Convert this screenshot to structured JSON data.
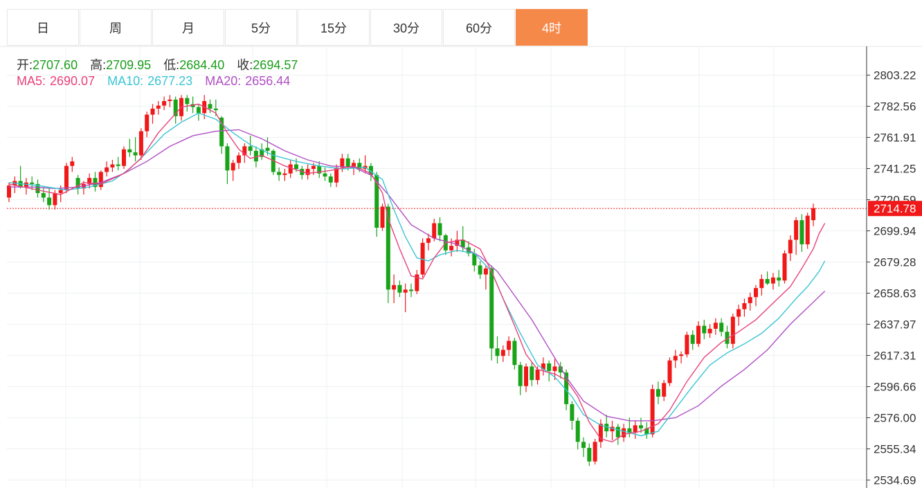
{
  "tabs": [
    {
      "label": "日",
      "active": false
    },
    {
      "label": "周",
      "active": false
    },
    {
      "label": "月",
      "active": false
    },
    {
      "label": "5分",
      "active": false
    },
    {
      "label": "15分",
      "active": false
    },
    {
      "label": "30分",
      "active": false
    },
    {
      "label": "60分",
      "active": false
    },
    {
      "label": "4时",
      "active": true
    }
  ],
  "info": {
    "open_label": "开:",
    "open": "2707.60",
    "high_label": "高:",
    "high": "2709.95",
    "low_label": "低:",
    "low": "2684.40",
    "close_label": "收:",
    "close": "2694.57",
    "ma5_label": "MA5:",
    "ma5": "2690.07",
    "ma10_label": "MA10:",
    "ma10": "2677.23",
    "ma20_label": "MA20:",
    "ma20": "2656.44"
  },
  "colors": {
    "up": "#f01818",
    "down": "#19a319",
    "ma5": "#e8417a",
    "ma10": "#3bc4d4",
    "ma20": "#b04ec4",
    "tab_active": "#f5894a"
  },
  "chart_data": {
    "type": "candlestick",
    "y_ticks": [
      "2803.22",
      "2782.56",
      "2761.91",
      "2741.25",
      "2720.59",
      "2699.94",
      "2679.28",
      "2658.63",
      "2637.97",
      "2617.31",
      "2596.66",
      "2576.00",
      "2555.34",
      "2534.69"
    ],
    "ylim": [
      2534.69,
      2803.22
    ],
    "current_price": "2714.78",
    "grid": true,
    "candles": [
      [
        2722,
        2732,
        2719,
        2730
      ],
      [
        2730,
        2736,
        2725,
        2733
      ],
      [
        2733,
        2743,
        2728,
        2729
      ],
      [
        2729,
        2735,
        2724,
        2732
      ],
      [
        2732,
        2736,
        2727,
        2731
      ],
      [
        2731,
        2734,
        2722,
        2725
      ],
      [
        2725,
        2729,
        2719,
        2722
      ],
      [
        2722,
        2728,
        2714,
        2717
      ],
      [
        2717,
        2727,
        2714,
        2725
      ],
      [
        2725,
        2730,
        2719,
        2727
      ],
      [
        2727,
        2745,
        2725,
        2743
      ],
      [
        2743,
        2749,
        2739,
        2746
      ],
      [
        2735,
        2737,
        2724,
        2728
      ],
      [
        2728,
        2733,
        2724,
        2731
      ],
      [
        2731,
        2738,
        2728,
        2735
      ],
      [
        2735,
        2739,
        2726,
        2729
      ],
      [
        2729,
        2740,
        2727,
        2739
      ],
      [
        2739,
        2746,
        2736,
        2742
      ],
      [
        2742,
        2747,
        2739,
        2744
      ],
      [
        2744,
        2749,
        2740,
        2743
      ],
      [
        2743,
        2756,
        2741,
        2754
      ],
      [
        2754,
        2761,
        2749,
        2752
      ],
      [
        2752,
        2762,
        2746,
        2750
      ],
      [
        2750,
        2768,
        2747,
        2766
      ],
      [
        2766,
        2779,
        2762,
        2777
      ],
      [
        2777,
        2784,
        2771,
        2781
      ],
      [
        2781,
        2786,
        2777,
        2783
      ],
      [
        2783,
        2789,
        2780,
        2786
      ],
      [
        2786,
        2790,
        2782,
        2787
      ],
      [
        2787,
        2789,
        2771,
        2776
      ],
      [
        2776,
        2790,
        2773,
        2788
      ],
      [
        2788,
        2790,
        2779,
        2784
      ],
      [
        2784,
        2789,
        2778,
        2782
      ],
      [
        2782,
        2784,
        2773,
        2778
      ],
      [
        2778,
        2790,
        2774,
        2786
      ],
      [
        2784,
        2787,
        2778,
        2781
      ],
      [
        2781,
        2787,
        2776,
        2780
      ],
      [
        2775,
        2776,
        2751,
        2756
      ],
      [
        2756,
        2758,
        2731,
        2740
      ],
      [
        2740,
        2747,
        2733,
        2745
      ],
      [
        2745,
        2752,
        2741,
        2750
      ],
      [
        2750,
        2758,
        2745,
        2756
      ],
      [
        2756,
        2763,
        2750,
        2753
      ],
      [
        2753,
        2756,
        2742,
        2746
      ],
      [
        2754,
        2758,
        2747,
        2749
      ],
      [
        2755,
        2762,
        2750,
        2753
      ],
      [
        2753,
        2754,
        2737,
        2739
      ],
      [
        2739,
        2742,
        2733,
        2737
      ],
      [
        2737,
        2741,
        2733,
        2738
      ],
      [
        2738,
        2747,
        2735,
        2744
      ],
      [
        2744,
        2748,
        2739,
        2741
      ],
      [
        2741,
        2743,
        2734,
        2737
      ],
      [
        2737,
        2744,
        2734,
        2741
      ],
      [
        2741,
        2745,
        2737,
        2743
      ],
      [
        2743,
        2746,
        2735,
        2738
      ],
      [
        2738,
        2742,
        2733,
        2736
      ],
      [
        2736,
        2738,
        2729,
        2732
      ],
      [
        2732,
        2744,
        2729,
        2742
      ],
      [
        2742,
        2751,
        2739,
        2748
      ],
      [
        2748,
        2751,
        2740,
        2742
      ],
      [
        2742,
        2747,
        2737,
        2745
      ],
      [
        2745,
        2748,
        2739,
        2741
      ],
      [
        2741,
        2750,
        2738,
        2743
      ],
      [
        2743,
        2745,
        2733,
        2737
      ],
      [
        2737,
        2739,
        2696,
        2702
      ],
      [
        2702,
        2718,
        2700,
        2716
      ],
      [
        2716,
        2718,
        2652,
        2661
      ],
      [
        2661,
        2671,
        2652,
        2664
      ],
      [
        2664,
        2667,
        2656,
        2659
      ],
      [
        2659,
        2665,
        2646,
        2661
      ],
      [
        2661,
        2665,
        2656,
        2660
      ],
      [
        2660,
        2674,
        2658,
        2671
      ],
      [
        2671,
        2695,
        2669,
        2692
      ],
      [
        2692,
        2698,
        2687,
        2695
      ],
      [
        2695,
        2708,
        2693,
        2705
      ],
      [
        2705,
        2709,
        2693,
        2697
      ],
      [
        2697,
        2698,
        2684,
        2687
      ],
      [
        2687,
        2695,
        2683,
        2690
      ],
      [
        2690,
        2700,
        2686,
        2694
      ],
      [
        2694,
        2703,
        2686,
        2689
      ],
      [
        2689,
        2693,
        2683,
        2685
      ],
      [
        2685,
        2688,
        2673,
        2677
      ],
      [
        2677,
        2680,
        2668,
        2671
      ],
      [
        2671,
        2677,
        2661,
        2675
      ],
      [
        2675,
        2677,
        2614,
        2622
      ],
      [
        2622,
        2630,
        2612,
        2617
      ],
      [
        2617,
        2624,
        2613,
        2621
      ],
      [
        2621,
        2630,
        2617,
        2627
      ],
      [
        2627,
        2629,
        2608,
        2611
      ],
      [
        2611,
        2613,
        2591,
        2597
      ],
      [
        2597,
        2612,
        2593,
        2610
      ],
      [
        2610,
        2613,
        2597,
        2601
      ],
      [
        2601,
        2610,
        2598,
        2608
      ],
      [
        2608,
        2616,
        2604,
        2612
      ],
      [
        2612,
        2614,
        2600,
        2607
      ],
      [
        2607,
        2615,
        2601,
        2610
      ],
      [
        2610,
        2613,
        2602,
        2606
      ],
      [
        2606,
        2608,
        2581,
        2585
      ],
      [
        2585,
        2587,
        2568,
        2574
      ],
      [
        2574,
        2576,
        2555,
        2560
      ],
      [
        2560,
        2563,
        2550,
        2556
      ],
      [
        2556,
        2559,
        2544,
        2547
      ],
      [
        2547,
        2562,
        2545,
        2560
      ],
      [
        2560,
        2575,
        2556,
        2572
      ],
      [
        2572,
        2578,
        2563,
        2567
      ],
      [
        2567,
        2574,
        2561,
        2570
      ],
      [
        2570,
        2572,
        2558,
        2563
      ],
      [
        2563,
        2572,
        2560,
        2569
      ],
      [
        2569,
        2576,
        2563,
        2566
      ],
      [
        2566,
        2574,
        2562,
        2571
      ],
      [
        2571,
        2576,
        2566,
        2569
      ],
      [
        2569,
        2573,
        2562,
        2565
      ],
      [
        2565,
        2598,
        2563,
        2595
      ],
      [
        2595,
        2600,
        2585,
        2590
      ],
      [
        2590,
        2601,
        2587,
        2599
      ],
      [
        2599,
        2616,
        2597,
        2614
      ],
      [
        2614,
        2621,
        2609,
        2617
      ],
      [
        2617,
        2620,
        2612,
        2618
      ],
      [
        2618,
        2633,
        2616,
        2631
      ],
      [
        2631,
        2634,
        2621,
        2625
      ],
      [
        2625,
        2640,
        2623,
        2637
      ],
      [
        2637,
        2641,
        2628,
        2632
      ],
      [
        2632,
        2638,
        2629,
        2635
      ],
      [
        2635,
        2642,
        2631,
        2639
      ],
      [
        2639,
        2642,
        2630,
        2633
      ],
      [
        2633,
        2637,
        2622,
        2625
      ],
      [
        2625,
        2645,
        2622,
        2643
      ],
      [
        2643,
        2651,
        2637,
        2648
      ],
      [
        2648,
        2655,
        2643,
        2652
      ],
      [
        2652,
        2659,
        2647,
        2656
      ],
      [
        2656,
        2664,
        2650,
        2662
      ],
      [
        2662,
        2671,
        2657,
        2668
      ],
      [
        2668,
        2673,
        2664,
        2665
      ],
      [
        2665,
        2672,
        2661,
        2669
      ],
      [
        2669,
        2674,
        2663,
        2667
      ],
      [
        2667,
        2687,
        2665,
        2685
      ],
      [
        2685,
        2697,
        2680,
        2694
      ],
      [
        2694,
        2709,
        2684,
        2707
      ],
      [
        2707,
        2711,
        2686,
        2691
      ],
      [
        2691,
        2712,
        2688,
        2710
      ],
      [
        2707,
        2718,
        2703,
        2715
      ]
    ],
    "ma5": [
      [
        0,
        2731
      ],
      [
        5,
        2727
      ],
      [
        9,
        2724
      ],
      [
        13,
        2732
      ],
      [
        16,
        2731
      ],
      [
        20,
        2738
      ],
      [
        23,
        2748
      ],
      [
        26,
        2765
      ],
      [
        30,
        2782
      ],
      [
        33,
        2784
      ],
      [
        36,
        2778
      ],
      [
        38,
        2765
      ],
      [
        40,
        2754
      ],
      [
        42,
        2748
      ],
      [
        44,
        2750
      ],
      [
        48,
        2743
      ],
      [
        52,
        2738
      ],
      [
        56,
        2740
      ],
      [
        60,
        2743
      ],
      [
        63,
        2738
      ],
      [
        65,
        2725
      ],
      [
        66,
        2708
      ],
      [
        68,
        2688
      ],
      [
        70,
        2670
      ],
      [
        72,
        2668
      ],
      [
        74,
        2682
      ],
      [
        76,
        2692
      ],
      [
        79,
        2694
      ],
      [
        82,
        2688
      ],
      [
        84,
        2673
      ],
      [
        86,
        2655
      ],
      [
        88,
        2637
      ],
      [
        90,
        2618
      ],
      [
        92,
        2608
      ],
      [
        95,
        2605
      ],
      [
        97,
        2601
      ],
      [
        99,
        2590
      ],
      [
        101,
        2573
      ],
      [
        103,
        2562
      ],
      [
        105,
        2560
      ],
      [
        107,
        2565
      ],
      [
        110,
        2567
      ],
      [
        113,
        2572
      ],
      [
        115,
        2581
      ],
      [
        118,
        2600
      ],
      [
        121,
        2616
      ],
      [
        124,
        2626
      ],
      [
        127,
        2633
      ],
      [
        130,
        2641
      ],
      [
        133,
        2652
      ],
      [
        136,
        2663
      ],
      [
        138,
        2675
      ],
      [
        140,
        2688
      ],
      [
        141,
        2698
      ],
      [
        142,
        2705
      ]
    ],
    "ma10": [
      [
        0,
        2732
      ],
      [
        5,
        2730
      ],
      [
        10,
        2727
      ],
      [
        14,
        2729
      ],
      [
        18,
        2733
      ],
      [
        21,
        2741
      ],
      [
        24,
        2752
      ],
      [
        27,
        2764
      ],
      [
        30,
        2772
      ],
      [
        33,
        2778
      ],
      [
        36,
        2774
      ],
      [
        39,
        2765
      ],
      [
        42,
        2757
      ],
      [
        46,
        2750
      ],
      [
        50,
        2746
      ],
      [
        54,
        2743
      ],
      [
        58,
        2741
      ],
      [
        62,
        2742
      ],
      [
        65,
        2734
      ],
      [
        67,
        2714
      ],
      [
        69,
        2696
      ],
      [
        71,
        2682
      ],
      [
        73,
        2680
      ],
      [
        75,
        2684
      ],
      [
        78,
        2687
      ],
      [
        81,
        2685
      ],
      [
        84,
        2673
      ],
      [
        86,
        2655
      ],
      [
        89,
        2632
      ],
      [
        92,
        2611
      ],
      [
        95,
        2603
      ],
      [
        98,
        2590
      ],
      [
        100,
        2578
      ],
      [
        103,
        2571
      ],
      [
        107,
        2567
      ],
      [
        110,
        2564
      ],
      [
        113,
        2567
      ],
      [
        116,
        2582
      ],
      [
        119,
        2597
      ],
      [
        122,
        2611
      ],
      [
        125,
        2619
      ],
      [
        128,
        2625
      ],
      [
        131,
        2632
      ],
      [
        134,
        2642
      ],
      [
        137,
        2655
      ],
      [
        139,
        2663
      ],
      [
        141,
        2673
      ],
      [
        142,
        2680
      ]
    ],
    "ma20": [
      [
        0,
        2729
      ],
      [
        4,
        2729
      ],
      [
        8,
        2728
      ],
      [
        12,
        2729
      ],
      [
        16,
        2732
      ],
      [
        20,
        2738
      ],
      [
        24,
        2746
      ],
      [
        28,
        2756
      ],
      [
        32,
        2763
      ],
      [
        36,
        2766
      ],
      [
        40,
        2767
      ],
      [
        44,
        2761
      ],
      [
        48,
        2753
      ],
      [
        52,
        2747
      ],
      [
        56,
        2743
      ],
      [
        60,
        2742
      ],
      [
        63,
        2737
      ],
      [
        66,
        2724
      ],
      [
        70,
        2704
      ],
      [
        74,
        2695
      ],
      [
        78,
        2691
      ],
      [
        82,
        2683
      ],
      [
        85,
        2673
      ],
      [
        88,
        2657
      ],
      [
        91,
        2641
      ],
      [
        94,
        2622
      ],
      [
        97,
        2603
      ],
      [
        100,
        2587
      ],
      [
        104,
        2577
      ],
      [
        108,
        2574
      ],
      [
        112,
        2574
      ],
      [
        116,
        2576
      ],
      [
        120,
        2584
      ],
      [
        124,
        2597
      ],
      [
        128,
        2608
      ],
      [
        132,
        2621
      ],
      [
        136,
        2638
      ],
      [
        139,
        2649
      ],
      [
        142,
        2660
      ]
    ]
  }
}
